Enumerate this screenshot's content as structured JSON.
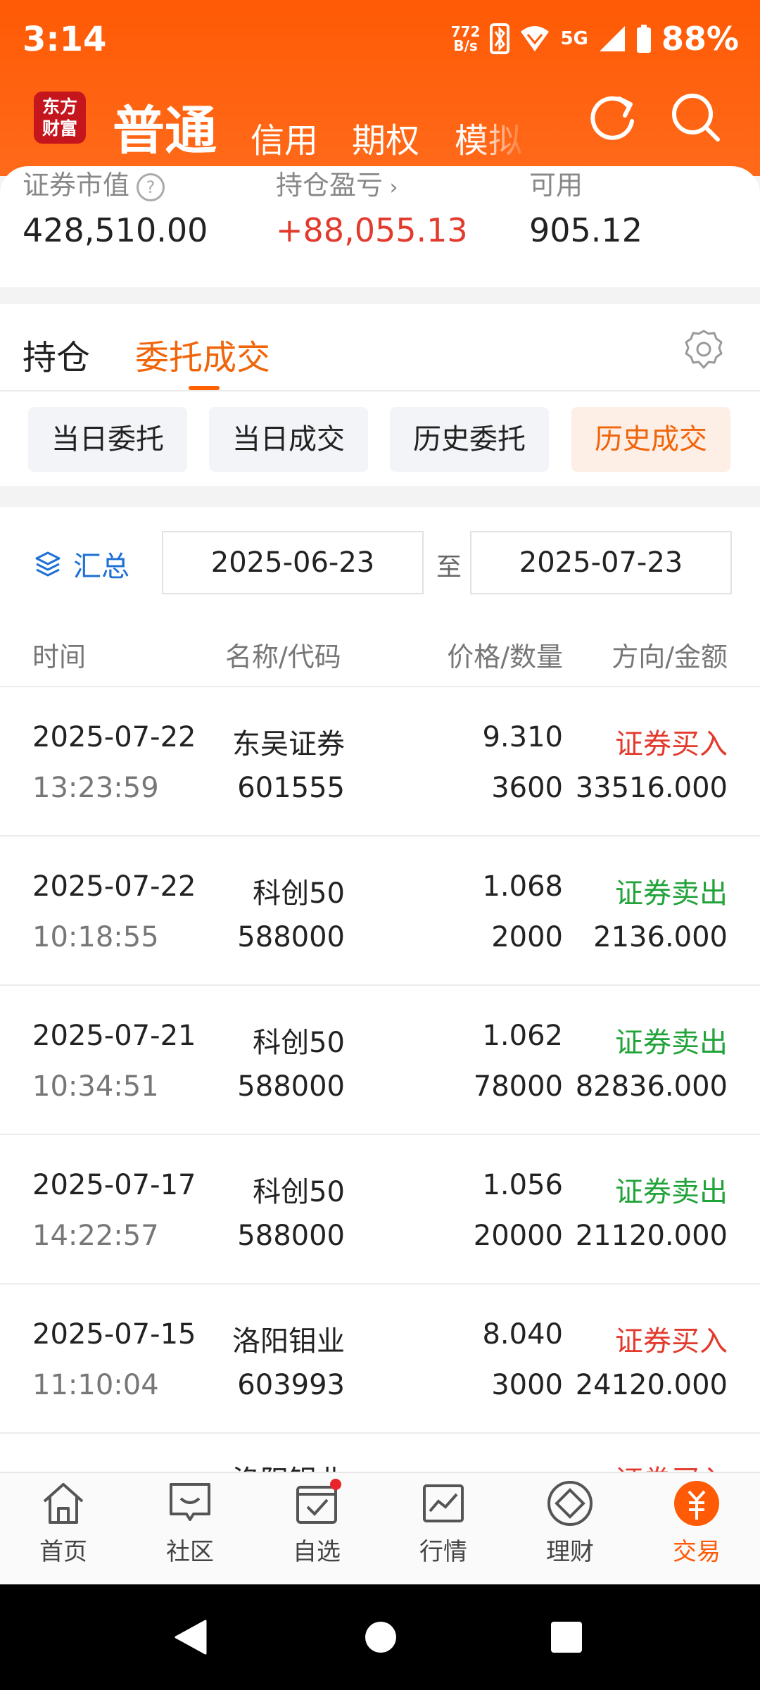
{
  "status_bar": {
    "time": "3:14",
    "net_speed_value": "772",
    "net_speed_unit": "B/s",
    "network": "5G",
    "battery": "88%"
  },
  "header": {
    "logo_text": "东方财富",
    "account_tabs": [
      "普通",
      "信用",
      "期权",
      "模拟"
    ],
    "active_account_tab": "普通"
  },
  "summary": {
    "market_value_label": "证券市值",
    "market_value": "428,510.00",
    "pnl_label": "持仓盈亏",
    "pnl_value": "+88,055.13",
    "available_label": "可用",
    "available_value": "905.12"
  },
  "tabs": {
    "holdings": "持仓",
    "orders": "委托成交"
  },
  "sub_tabs": [
    "当日委托",
    "当日成交",
    "历史委托",
    "历史成交"
  ],
  "filter": {
    "summary_label": "汇总",
    "start_date": "2025-06-23",
    "to_label": "至",
    "end_date": "2025-07-23"
  },
  "table": {
    "headers": {
      "time": "时间",
      "name": "名称/代码",
      "price": "价格/数量",
      "direction": "方向/金额"
    },
    "rows": [
      {
        "date": "2025-07-22",
        "time": "13:23:59",
        "name": "东吴证券",
        "code": "601555",
        "price": "9.310",
        "qty": "3600",
        "direction": "证券买入",
        "amount": "33516.000"
      },
      {
        "date": "2025-07-22",
        "time": "10:18:55",
        "name": "科创50",
        "code": "588000",
        "price": "1.068",
        "qty": "2000",
        "direction": "证券卖出",
        "amount": "2136.000"
      },
      {
        "date": "2025-07-21",
        "time": "10:34:51",
        "name": "科创50",
        "code": "588000",
        "price": "1.062",
        "qty": "78000",
        "direction": "证券卖出",
        "amount": "82836.000"
      },
      {
        "date": "2025-07-17",
        "time": "14:22:57",
        "name": "科创50",
        "code": "588000",
        "price": "1.056",
        "qty": "20000",
        "direction": "证券卖出",
        "amount": "21120.000"
      },
      {
        "date": "2025-07-15",
        "time": "11:10:04",
        "name": "洛阳钼业",
        "code": "603993",
        "price": "8.040",
        "qty": "3000",
        "direction": "证券买入",
        "amount": "24120.000"
      }
    ],
    "partial_row": {
      "name": "洛阳钼业",
      "direction": "证券买入"
    }
  },
  "bottom_nav": [
    "首页",
    "社区",
    "自选",
    "行情",
    "理财",
    "交易"
  ],
  "colors": {
    "brand": "#ff5a05",
    "buy": "#e23a2d",
    "sell": "#21a33a",
    "accent_text": "#f0650a"
  }
}
